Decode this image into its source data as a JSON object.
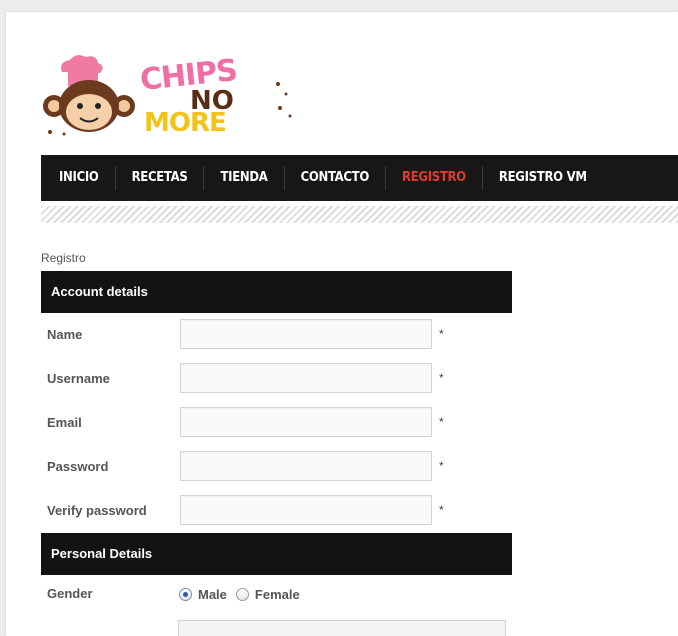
{
  "logo": {
    "words": [
      "CHIPS",
      "NO",
      "MORE"
    ]
  },
  "nav": {
    "items": [
      "INICIO",
      "RECETAS",
      "TIENDA",
      "CONTACTO",
      "REGISTRO",
      "REGISTRO VM"
    ],
    "active_index": 4,
    "active_color": "#e33a30"
  },
  "breadcrumb": "Registro",
  "account_section": {
    "title": "Account details",
    "fields": [
      {
        "label": "Name",
        "value": "",
        "required_mark": "*"
      },
      {
        "label": "Username",
        "value": "",
        "required_mark": "*"
      },
      {
        "label": "Email",
        "value": "",
        "required_mark": "*"
      },
      {
        "label": "Password",
        "value": "",
        "required_mark": "*"
      },
      {
        "label": "Verify password",
        "value": "",
        "required_mark": "*"
      }
    ]
  },
  "personal_section": {
    "title": "Personal Details",
    "gender": {
      "label": "Gender",
      "options": [
        "Male",
        "Female"
      ],
      "selected": "Male"
    }
  }
}
